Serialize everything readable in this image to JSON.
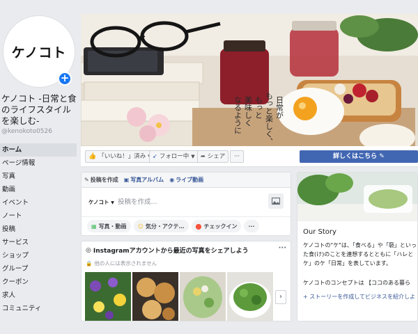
{
  "page": {
    "avatar_text": "ケノコト",
    "name": "ケノコト -日常と食のライフスタイルを楽しむ-",
    "handle": "@kenokoto0526"
  },
  "nav": [
    "ホーム",
    "ページ情報",
    "写真",
    "動画",
    "イベント",
    "ノート",
    "投稿",
    "サービス",
    "ショップ",
    "グループ",
    "クーポン",
    "求人",
    "コミュニティ"
  ],
  "cover": {
    "tagline_col1": "日常が",
    "tagline_col2": "もっと楽しく、",
    "tagline_col3": "もっと",
    "tagline_col4": "美味しく",
    "tagline_col5": "なるように"
  },
  "actions": {
    "like": "「いいね！」済み",
    "follow": "フォロー中",
    "share": "シェア",
    "more": "···",
    "learn_more": "詳しくはこちら"
  },
  "composer": {
    "tabs": [
      "投稿を作成",
      "写真アルバム",
      "ライブ動画"
    ],
    "who": "ケノコト",
    "placeholder": "投稿を作成...",
    "buttons": [
      "写真・動画",
      "気分・アクテ…",
      "チェックイン"
    ],
    "more": "···"
  },
  "instagram": {
    "title": "Instagramアカウントから最近の写真をシェアしよう",
    "subtitle": "他の人には表示されません",
    "more": "···",
    "next": "›"
  },
  "story": {
    "heading": "Our Story",
    "p1": "ケノコトの\"ケ\"は、「食べる」や「褻」といった食(け)のことを連想するとともに「ハレとケ」のケ「日常」を表しています。",
    "p2": "ケノコトのコンセプトは 【ココのある暮ら",
    "link": "+ ストーリーを作成してビジネスを紹介しよ"
  },
  "colors": {
    "fb_blue": "#4267b2",
    "link_blue": "#385898",
    "background": "#e9ebee"
  }
}
